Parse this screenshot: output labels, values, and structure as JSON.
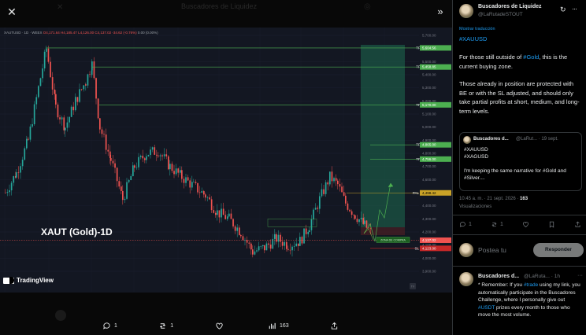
{
  "media": {
    "ghost_title": "Buscadores de Liquidez",
    "close_glyph": "✕",
    "collapse_glyph": "»",
    "chart": {
      "ohlc_symbol": "XAUTUSD · 1D · WEEX",
      "ohlc_values": "O4,171.64 H4,185.47 L4,126.00 C4,137.02 -34.62 (-0.76%)",
      "ohlc_extra": "0.00 (0.00%)",
      "watermark": "XAUT (Gold)-1D",
      "brand": "TradingView",
      "tp_label": "TP",
      "pal_label": "PAL",
      "sl_label": "SL",
      "entry_label": "ZONA DE COMPRA",
      "price_ticks": [
        "5,700.00",
        "5,600.00",
        "5,500.00",
        "5,400.00",
        "5,300.00",
        "5,200.00",
        "5,100.00",
        "5,000.00",
        "4,900.00",
        "4,800.00",
        "4,700.00",
        "4,600.00",
        "4,500.00",
        "4,400.00",
        "4,300.00",
        "4,200.00",
        "4,100.00",
        "4,000.00",
        "3,900.00"
      ],
      "tp_prices": [
        "5,604.56",
        "5,458.85",
        "5,170.00",
        "4,865.00",
        "4,756.00"
      ],
      "pal_price": "4,498.42",
      "current_price": "4,137.02",
      "sl_price": "4,123.00",
      "month_labels": [
        "2,2026",
        "Feb",
        "Mar",
        "Apr",
        "May",
        "Jun",
        "Jul",
        "Aug",
        "Sep",
        "Oct"
      ],
      "tv_badge": "TV",
      "colors": {
        "up": "#26a69a",
        "down": "#ef5350",
        "tp": "#4caf50",
        "zone": "#1b5e4a",
        "bg": "#131722"
      }
    },
    "actions": {
      "replies": "1",
      "reposts": "1",
      "likes": "",
      "views": "163"
    }
  },
  "post": {
    "author_name": "Buscadores de Liquidez",
    "author_handle": "@LaRutadeSTOUT",
    "translate_label": "Mostrar traducción",
    "hashtag": "#XAUUSD",
    "p1_before": "For those still outside of ",
    "p1_link": "#Gold",
    "p1_after": ", this is the current buying zone.",
    "p2": "Those already in position are protected with BE or with the SL adjusted, and should only take partial profits at short, medium, and long-term levels.",
    "quote": {
      "name": "Buscadores d...",
      "meta": "@LaRut... · 19 sept.",
      "line1": "#XAUUSD",
      "line2": "#XAGUSD",
      "line3": "I'm keeping the same narrative for #Gold and #Silver...."
    },
    "time": "10:45 a. m. · 21 sept. 2026 · ",
    "views_count": "163",
    "views_label": "Visualizaciones",
    "stats": {
      "replies": "1",
      "reposts": "1",
      "likes": "",
      "bookmarks": "",
      "share": ""
    }
  },
  "reply_box": {
    "placeholder": "Postea tu",
    "button": "Responder"
  },
  "reply": {
    "name": "Buscadores d...",
    "meta": "@LaRuta... · 1h",
    "more": "···",
    "before": "* Remember: If you ",
    "link1": "#trade",
    "middle": " using my link, you automatically participate in the Buscadores Challenge, where I personally give out ",
    "link2": "#USDT",
    "after": " prizes every month to those who move the most volume."
  }
}
